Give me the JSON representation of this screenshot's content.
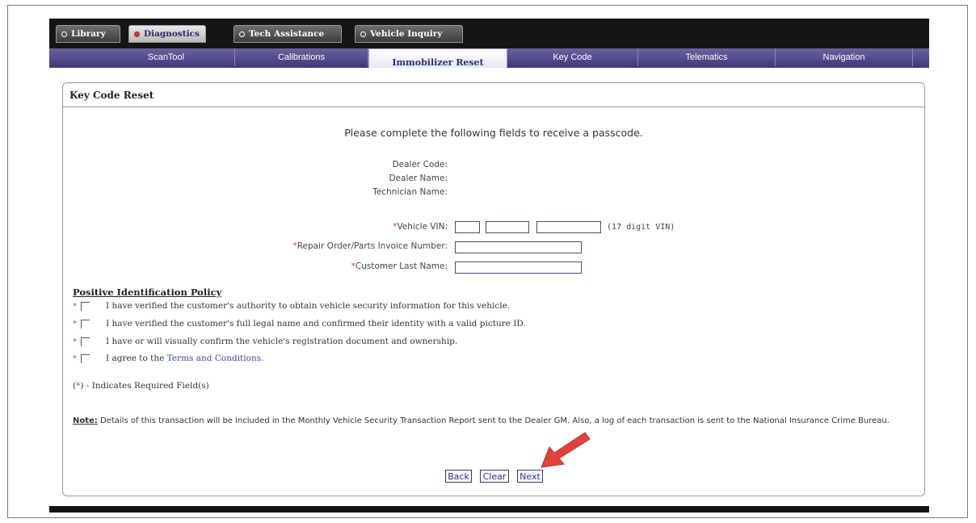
{
  "top_tabs": [
    {
      "label": "Library",
      "active": false
    },
    {
      "label": "Diagnostics",
      "active": true
    },
    {
      "label": "Tech Assistance",
      "active": false
    },
    {
      "label": "Vehicle Inquiry",
      "active": false
    }
  ],
  "sub_tabs": [
    {
      "label": "ScanTool"
    },
    {
      "label": "Calibrations"
    },
    {
      "label": "Immobilizer Reset"
    },
    {
      "label": "Key Code"
    },
    {
      "label": "Telematics"
    },
    {
      "label": "Navigation"
    }
  ],
  "panel": {
    "title": "Key Code Reset",
    "instruction": "Please complete the following fields to receive a passcode.",
    "info": {
      "dealer_code_label": "Dealer Code:",
      "dealer_name_label": "Dealer Name:",
      "technician_name_label": "Technician Name:"
    },
    "fields": {
      "vin_label": "Vehicle VIN:",
      "vin_hint": "(17 digit VIN)",
      "repair_order_label": "Repair Order/Parts Invoice Number:",
      "customer_last_name_label": "Customer Last Name:"
    },
    "policy": {
      "title": "Positive Identification Policy",
      "items": [
        "I have verified the customer's authority to obtain vehicle security information for this vehicle.",
        "I have verified the customer's full legal name and confirmed their identity with a valid picture ID.",
        "I have or will visually confirm the vehicle's registration document and ownership."
      ],
      "terms_prefix": "I agree to the ",
      "terms_link": "Terms and Conditions."
    },
    "required_note_star": "*",
    "required_note_text": " - Indicates Required Field(s)",
    "note_label": "Note:",
    "note_text": " Details of this transaction will be included in the Monthly Vehicle Security Transaction Report sent to the Dealer GM. Also, a log of each transaction is sent to the National Insurance Crime Bureau.",
    "buttons": {
      "back": "Back",
      "clear": "Clear",
      "next": "Next"
    }
  },
  "colors": {
    "accent": "#4a4290",
    "required": "#d04040",
    "arrow": "#e0413c"
  }
}
